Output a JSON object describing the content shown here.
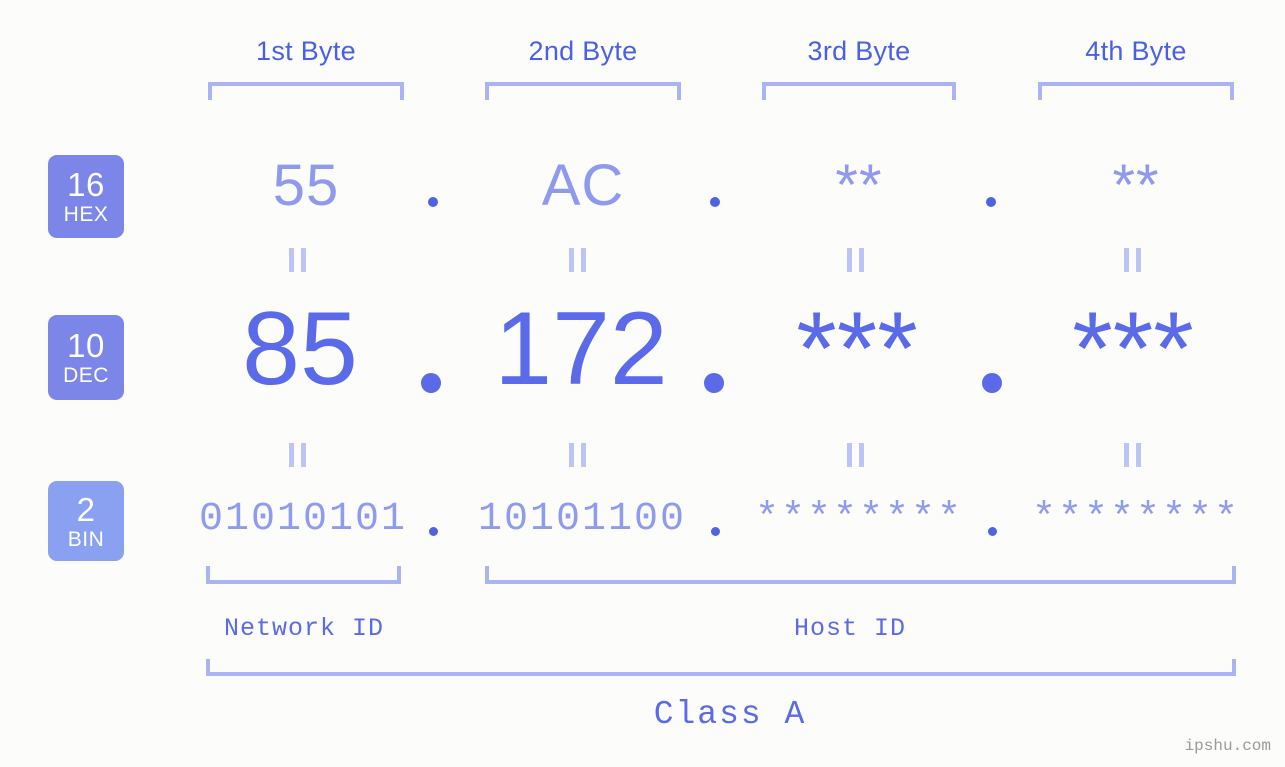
{
  "background_color": "#fcfdfa",
  "accent_colors": {
    "badge_fill": "#7b86e8",
    "badge_fill_bin": "#8aa0f0",
    "bracket": "#aab4f2",
    "header_text": "#4a5fe8",
    "hex_text": "#8f99ee",
    "dec_text": "#5a6ae8",
    "bin_text": "#8f9bf0",
    "eq_mark": "#bcc4f5",
    "watermark_text": "#9a9a9a"
  },
  "byte_headers": [
    {
      "label": "1st Byte"
    },
    {
      "label": "2nd Byte"
    },
    {
      "label": "3rd Byte"
    },
    {
      "label": "4th Byte"
    }
  ],
  "rows": [
    {
      "radix_number": "16",
      "radix_name": "HEX",
      "values": [
        "55",
        "AC",
        "**",
        "**"
      ],
      "separator": "."
    },
    {
      "radix_number": "10",
      "radix_name": "DEC",
      "values": [
        "85",
        "172",
        "***",
        "***"
      ],
      "separator": "."
    },
    {
      "radix_number": "2",
      "radix_name": "BIN",
      "values": [
        "01010101",
        "10101100",
        "********",
        "********"
      ],
      "separator": "."
    }
  ],
  "equality_marker": "||",
  "regions": [
    {
      "label": "Network ID"
    },
    {
      "label": "Host ID"
    }
  ],
  "class": {
    "label": "Class A"
  },
  "watermark": {
    "text": "ipshu.com"
  }
}
